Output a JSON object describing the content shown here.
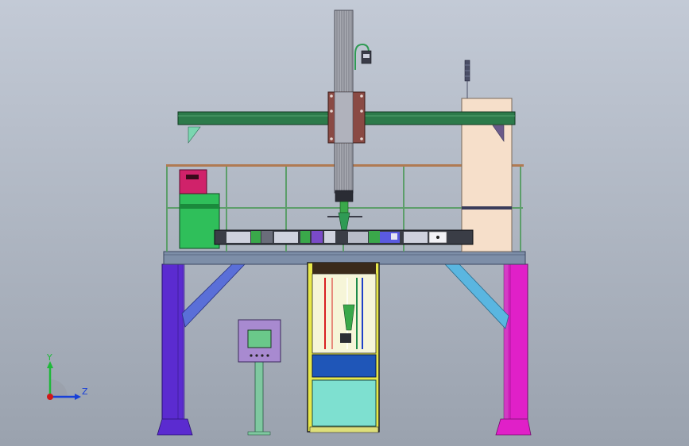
{
  "view": {
    "background_top": "#c3cad6",
    "background_bottom": "#9aa2ae"
  },
  "triad": {
    "y_label": "Y",
    "z_label": "Z",
    "y_color": "#1fb83a",
    "z_color": "#1840d8",
    "origin_color": "#d01818"
  },
  "colors": {
    "left_column": "#5b2bd0",
    "right_column": "#e020c8",
    "braces": "#5a6fd8",
    "right_braces": "#5ab6e0",
    "crossbeam": "#2c7a4a",
    "mast": "#a8aab2",
    "carriage": "#8a4a44",
    "platform_deck": "#7d8ea8",
    "railing": "#5c9e6a",
    "conveyor": "#3a3d46",
    "green_cabinet": "#2fbf5a",
    "magenta_box": "#d0226a",
    "tower_cabinet": "#f6dfca",
    "control_panel": "#a88ad0",
    "panel_screen": "#6ac88a",
    "enclosure_frame": "#e8e84a",
    "enclosure_lower": "#7ee0d0",
    "enclosure_band": "#1f56b8"
  }
}
